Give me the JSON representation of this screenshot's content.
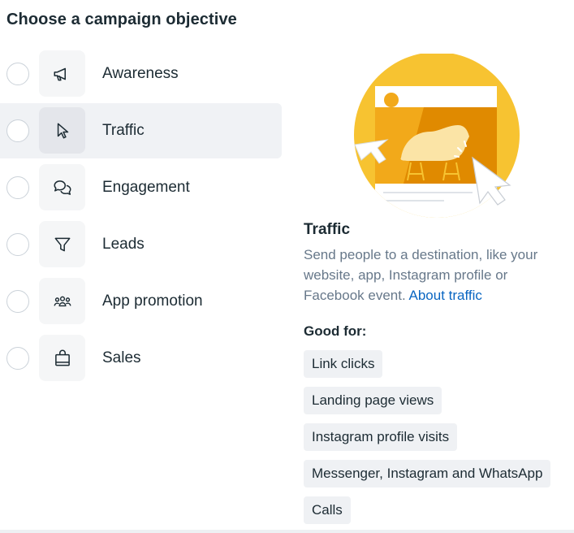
{
  "heading": "Choose a campaign objective",
  "objectives": [
    {
      "label": "Awareness",
      "icon": "megaphone-icon",
      "selected": false
    },
    {
      "label": "Traffic",
      "icon": "cursor-icon",
      "selected": true
    },
    {
      "label": "Engagement",
      "icon": "chat-bubbles-icon",
      "selected": false
    },
    {
      "label": "Leads",
      "icon": "funnel-icon",
      "selected": false
    },
    {
      "label": "App promotion",
      "icon": "people-group-icon",
      "selected": false
    },
    {
      "label": "Sales",
      "icon": "shopping-bag-icon",
      "selected": false
    }
  ],
  "detail": {
    "title": "Traffic",
    "description": "Send people to a destination, like your website, app, Instagram profile or Facebook event.",
    "link_text": "About traffic",
    "good_for_heading": "Good for:",
    "good_for": [
      "Link clicks",
      "Landing page views",
      "Instagram profile visits",
      "Messenger, Instagram and WhatsApp",
      "Calls"
    ]
  },
  "colors": {
    "accent_link": "#0a66c2",
    "illustration_yellow": "#f7c331",
    "illustration_orange": "#e08a00"
  }
}
